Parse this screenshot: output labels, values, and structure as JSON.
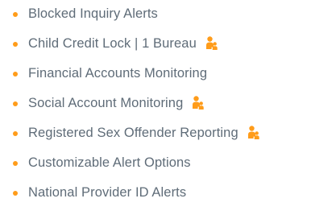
{
  "features": {
    "items": [
      {
        "label": "Blocked Inquiry Alerts",
        "icon": null
      },
      {
        "label": "Child Credit Lock | 1 Bureau",
        "icon": "family-icon"
      },
      {
        "label": "Financial Accounts Monitoring",
        "icon": null
      },
      {
        "label": "Social Account Monitoring",
        "icon": "family-icon"
      },
      {
        "label": "Registered Sex Offender Reporting",
        "icon": "family-icon"
      },
      {
        "label": "Customizable Alert Options",
        "icon": null
      },
      {
        "label": "National Provider ID Alerts",
        "icon": null
      }
    ]
  },
  "colors": {
    "text": "#5f6c78",
    "accent": "#ff9c1a"
  }
}
